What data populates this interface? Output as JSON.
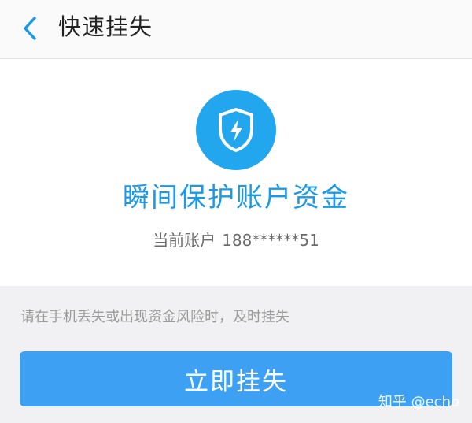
{
  "header": {
    "title": "快速挂失",
    "back_icon": "chevron-left-icon"
  },
  "hero": {
    "icon": "shield-lightning-icon",
    "title": "瞬间保护账户资金",
    "account_label": "当前账户",
    "account_number": "188******51"
  },
  "hint": "请在手机丢失或出现资金风险时，及时挂失",
  "action": {
    "button_label": "立即挂失"
  },
  "watermark": "知乎 @echo",
  "colors": {
    "accent": "#22a6ee",
    "title_blue": "#1a9ae6",
    "button_blue": "#3da0f3",
    "background": "#f1f1f3"
  }
}
